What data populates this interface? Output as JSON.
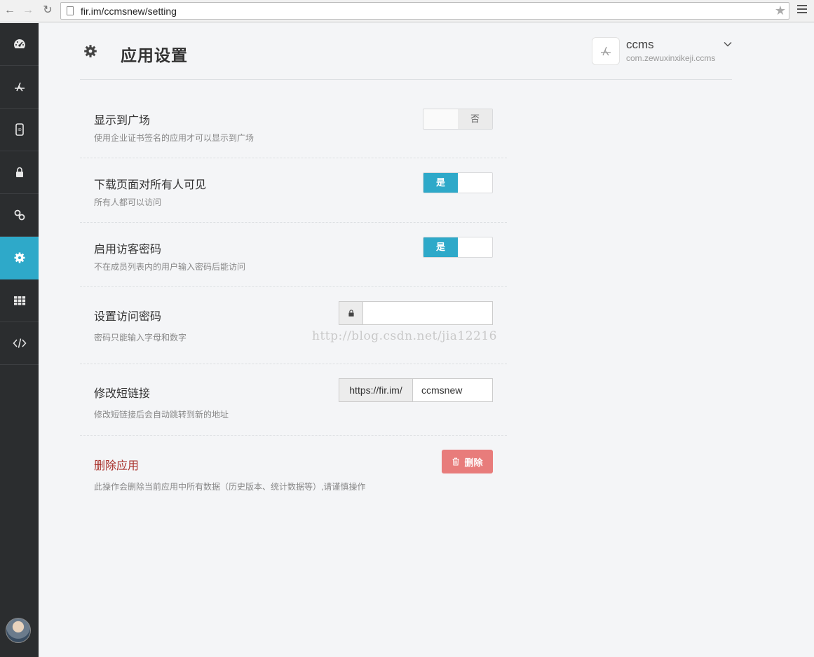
{
  "browser": {
    "url": "fir.im/ccmsnew/setting",
    "back_icon": "back-arrow-icon",
    "forward_icon": "forward-arrow-icon",
    "reload_icon": "reload-icon",
    "bookmark_icon": "star-icon",
    "menu_icon": "hamburger-menu-icon"
  },
  "sidebar": {
    "items": [
      {
        "name": "dashboard",
        "icon": "dashboard-icon",
        "active": false
      },
      {
        "name": "apps",
        "icon": "app-store-icon",
        "active": false
      },
      {
        "name": "devices",
        "icon": "device-id-icon",
        "active": false
      },
      {
        "name": "security",
        "icon": "lock-icon",
        "active": false
      },
      {
        "name": "links",
        "icon": "link-icon",
        "active": false
      },
      {
        "name": "settings",
        "icon": "gear-icon",
        "active": true
      },
      {
        "name": "grid",
        "icon": "grid-icon",
        "active": false
      },
      {
        "name": "code",
        "icon": "code-icon",
        "active": false
      }
    ],
    "accent_color": "#2ea9c9"
  },
  "header": {
    "title": "应用设置",
    "app_name": "ccms",
    "app_bundle": "com.zewuxinxikeji.ccms"
  },
  "settings": {
    "plaza": {
      "title": "显示到广场",
      "desc": "使用企业证书签名的应用才可以显示到广场",
      "toggle_off_label": "否",
      "enabled": false
    },
    "public_download": {
      "title": "下载页面对所有人可见",
      "desc": "所有人都可以访问",
      "toggle_on_label": "是",
      "enabled": true
    },
    "visitor_password": {
      "title": "启用访客密码",
      "desc": "不在成员列表内的用户输入密码后能访问",
      "toggle_on_label": "是",
      "enabled": true
    },
    "set_password": {
      "title": "设置访问密码",
      "desc": "密码只能输入字母和数字",
      "value": ""
    },
    "short_link": {
      "title": "修改短链接",
      "desc": "修改短链接后会自动跳转到新的地址",
      "prefix": "https://fir.im/",
      "value": "ccmsnew"
    },
    "delete_app": {
      "title": "删除应用",
      "desc": "此操作会删除当前应用中所有数据（历史版本、统计数据等）,请谨慎操作",
      "button_label": "删除",
      "button_color": "#e87c7b"
    }
  },
  "watermark": "http://blog.csdn.net/jia12216"
}
